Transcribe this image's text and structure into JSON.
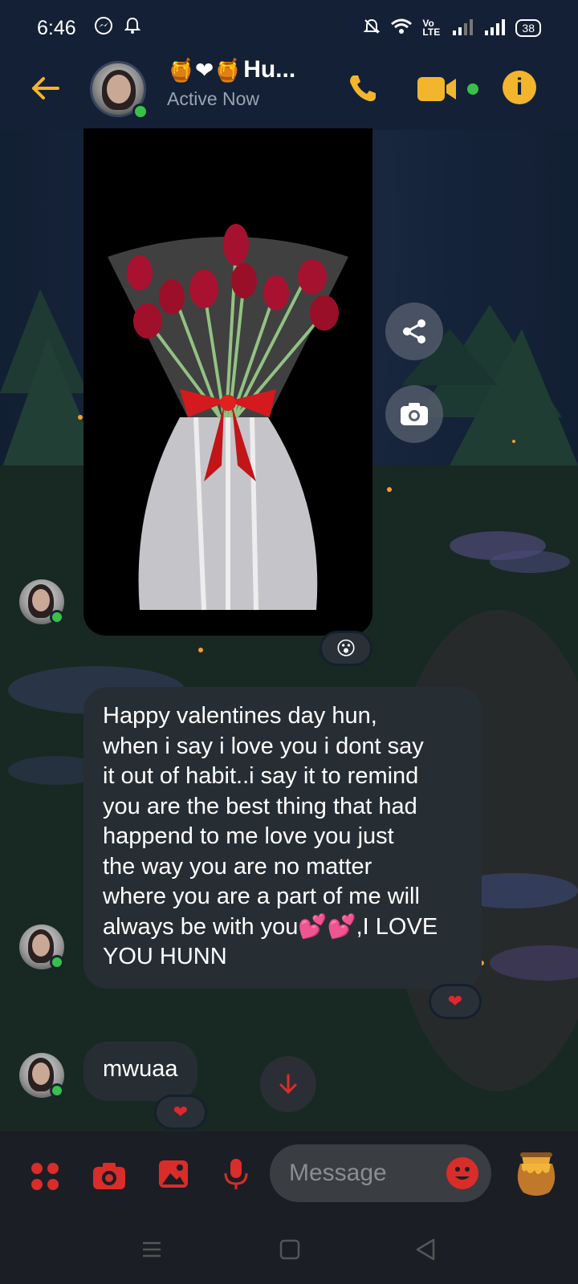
{
  "status_bar": {
    "time": "6:46",
    "battery": "38",
    "network_label": "Vo LTE"
  },
  "header": {
    "contact_name": "Hu...",
    "name_prefix_emoji": "🍯❤🍯",
    "status": "Active Now"
  },
  "messages": [
    {
      "type": "image",
      "description_icons": [
        "share-icon",
        "camera-icon"
      ],
      "reaction": "😮"
    },
    {
      "type": "text",
      "lines": [
        "Happy valentines day hun,",
        "when i say i love you i dont say",
        "it out of habit..i say it to remind",
        "you are the best thing that had",
        "happend to me  love you just",
        "the way you are no matter",
        "where you are a part of me will",
        "always be with you💕💕,I LOVE",
        "YOU HUNN"
      ],
      "reaction": "❤"
    },
    {
      "type": "text",
      "lines": [
        "mwuaa"
      ],
      "reaction": "❤"
    }
  ],
  "composer": {
    "placeholder": "Message"
  },
  "colors": {
    "accent": "#f2b52c",
    "composer_icons": "#d92d2a",
    "online": "#36c24a",
    "bubble": "#262e34"
  }
}
